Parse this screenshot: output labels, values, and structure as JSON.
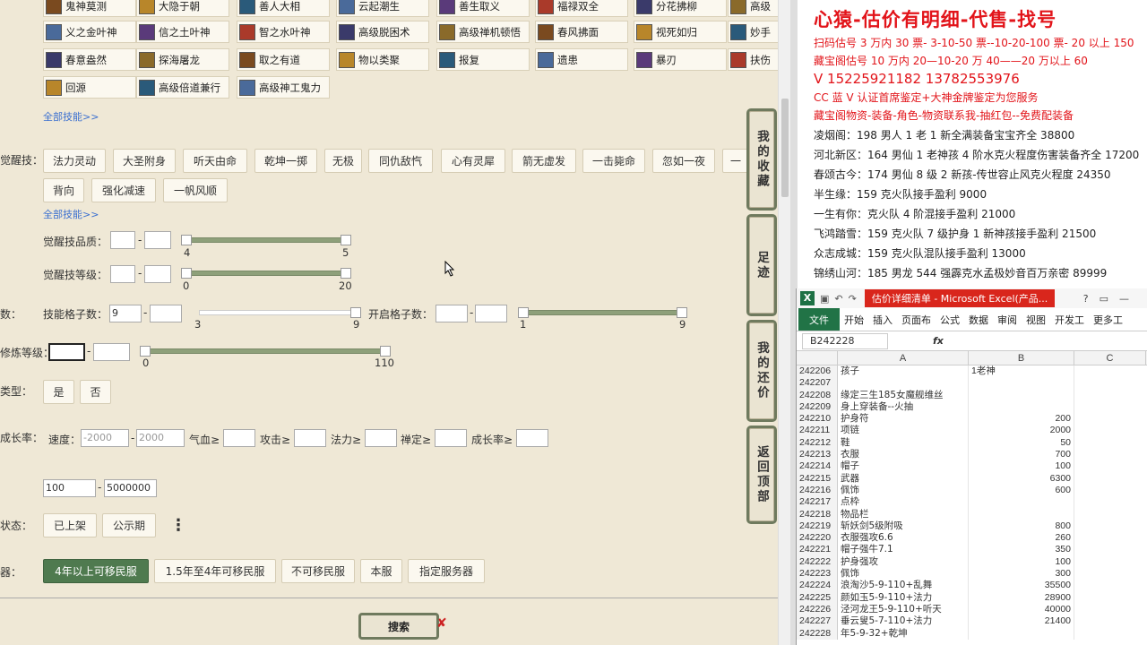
{
  "skills": {
    "row0": [
      "鬼神莫测",
      "大隐于朝",
      "善人大相",
      "云起潮生",
      "善生取义",
      "福禄双全",
      "分花拂柳",
      "高级"
    ],
    "row1": [
      "义之金叶神",
      "信之土叶神",
      "智之水叶神",
      "高级脱困术",
      "高级禅机顿悟",
      "春风拂面",
      "视死如归",
      "妙手"
    ],
    "row2": [
      "春意盎然",
      "探海屠龙",
      "取之有道",
      "物以类聚",
      "报复",
      "遗患",
      "暴刃",
      "扶伤"
    ],
    "row3": [
      "回源",
      "高级倍道兼行",
      "高级神工鬼力"
    ],
    "more1": "全部技能>>"
  },
  "awaken": {
    "label": "觉醒技：",
    "items": [
      "法力灵动",
      "大圣附身",
      "听天由命",
      "乾坤一掷",
      "无极",
      "同仇敌忾",
      "心有灵犀",
      "箭无虚发",
      "一击毙命",
      "忽如一夜",
      "一"
    ],
    "items2": [
      "背向",
      "强化减速",
      "一帆风顺"
    ],
    "more": "全部技能>>",
    "quality_label": "觉醒技品质：",
    "quality_min": "4",
    "quality_max": "5",
    "level_label": "觉醒技等级：",
    "level_min": "0",
    "level_max": "20"
  },
  "slots": {
    "label": "数：",
    "skill_slots_label": "技能格子数：",
    "skill_slots_value": "9",
    "skill_min": "3",
    "skill_max": "9",
    "open_slots_label": "开启格子数：",
    "open_min": "1",
    "open_max": "9"
  },
  "cultivation": {
    "label": "修炼等级：",
    "min": "0",
    "max": "110"
  },
  "type": {
    "label": "类型：",
    "yes": "是",
    "no": "否"
  },
  "growth": {
    "label": "成长率：",
    "speed_label": "速度：",
    "speed_min_ph": "-2000",
    "speed_max_ph": "2000",
    "hp_label": "气血≥",
    "atk_label": "攻击≥",
    "mag_label": "法力≥",
    "def_label": "禅定≥",
    "rate_label": "成长率≥"
  },
  "price": {
    "min": "100",
    "max": "5000000"
  },
  "status": {
    "label": "状态：",
    "on_shelf": "已上架",
    "public": "公示期",
    "more": "⋮"
  },
  "server": {
    "label": "器：",
    "options": [
      "4年以上可移民服",
      "1.5年至4年可移民服",
      "不可移民服",
      "本服",
      "指定服务器"
    ],
    "selected": "4年以上可移民服"
  },
  "sidebar": {
    "fav": "我的收藏",
    "footprint": "足迹",
    "bargain": "我的还价",
    "top": "返回顶部"
  },
  "search_label": "搜索",
  "doc": {
    "title": "心猿-估价有明细-代售-找号",
    "line1": "扫码估号 3 万内 30 票- 3-10-50 票--10-20-100 票- 20 以上 150",
    "line2": "藏宝阁估号 10 万内 20—10-20 万 40——20 万以上 60",
    "phone": "V 15225921182    13782553976",
    "line3": "CC 蓝 V 认证首席鉴定+大神金牌鉴定为您服务",
    "line4": "藏宝阁物资-装备-角色-物资联系我-抽红包--免费配装备",
    "entries": [
      "凌烟阁：198 男人 1 老 1 新全满装备宝宝齐全 38800",
      "河北新区：164 男仙 1 老神孩 4 阶水克火程度伤害装备齐全 17200",
      "春颂古今：174 男仙 8 级 2 新孩-传世容止风克火程度 24350",
      "半生缘：159 克火队接手盈利 9000",
      "一生有你：克火队 4 阶混接手盈利 21000",
      "飞鸿踏雪：159 克火队 7 级护身 1 新神孩接手盈利 21500",
      "众志成城：159 克火队混队接手盈利 13000",
      "锦绣山河：185 男龙 544 强霹克水孟极妙音百万亲密 89999"
    ]
  },
  "excel": {
    "filename": "估价详细清单 - Microsoft Excel(产品...",
    "tabs": [
      "开始",
      "插入",
      "页面布",
      "公式",
      "数据",
      "审阅",
      "视图",
      "开发工",
      "更多工"
    ],
    "file_tab": "文件",
    "namebox": "B242228",
    "col_headers": [
      "A",
      "B",
      "C"
    ],
    "rows": [
      [
        "242206",
        "孩子",
        "1老神",
        "left"
      ],
      [
        "242207",
        "",
        "",
        ""
      ],
      [
        "242208",
        "缘定三生185女魔舰维丝",
        "",
        ""
      ],
      [
        "242209",
        "身上穿装备--火抽",
        "",
        ""
      ],
      [
        "242210",
        "护身符",
        "200",
        ""
      ],
      [
        "242211",
        "项链",
        "2000",
        ""
      ],
      [
        "242212",
        "鞋",
        "50",
        ""
      ],
      [
        "242213",
        "衣服",
        "700",
        ""
      ],
      [
        "242214",
        "帽子",
        "100",
        ""
      ],
      [
        "242215",
        "武器",
        "6300",
        ""
      ],
      [
        "242216",
        "佩饰",
        "600",
        ""
      ],
      [
        "242217",
        "点枠",
        "",
        ""
      ],
      [
        "242218",
        "物品栏",
        "",
        ""
      ],
      [
        "242219",
        "斩妖剑5级附吸",
        "800",
        ""
      ],
      [
        "242220",
        "衣服强攻6.6",
        "260",
        ""
      ],
      [
        "242221",
        "帽子强牛7.1",
        "350",
        ""
      ],
      [
        "242222",
        "护身强攻",
        "100",
        ""
      ],
      [
        "242223",
        "佩饰",
        "300",
        ""
      ],
      [
        "242224",
        "浪淘沙5-9-110+乱舞",
        "35500",
        ""
      ],
      [
        "242225",
        "颜如玉5-9-110+法力",
        "28900",
        ""
      ],
      [
        "242226",
        "泾河龙王5-9-110+听天",
        "40000",
        ""
      ],
      [
        "242227",
        "垂云叟5-7-110+法力",
        "21400",
        ""
      ],
      [
        "242228",
        "年5-9-32+乾坤",
        "",
        ""
      ]
    ]
  },
  "colors": {
    "selected_green": "#4f7a4f",
    "doc_red": "#e2141a",
    "excel_green": "#217346",
    "link_blue": "#3a6fd0"
  }
}
